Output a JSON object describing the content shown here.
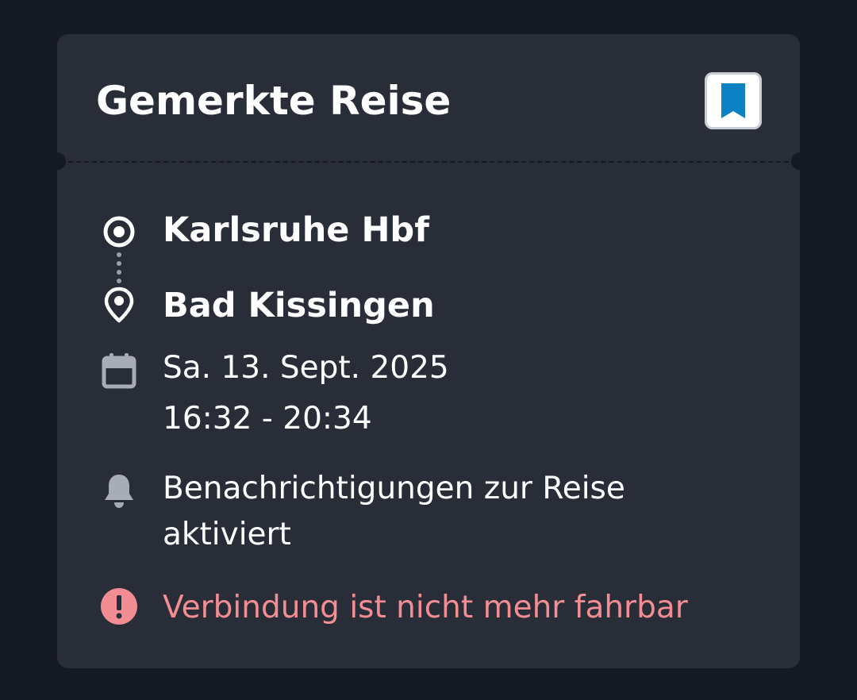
{
  "card": {
    "title": "Gemerkte Reise",
    "bookmark_icon": "bookmark-icon",
    "accent_color": "#0c82c5"
  },
  "journey": {
    "origin": "Karlsruhe Hbf",
    "destination": "Bad Kissingen",
    "date": "Sa. 13. Sept. 2025",
    "time": "16:32 - 20:34"
  },
  "notifications": {
    "line1": "Benachrichtigungen zur Reise",
    "line2": "aktiviert"
  },
  "alert": {
    "text": "Verbindung ist nicht mehr fahrbar",
    "color": "#f28e93"
  }
}
